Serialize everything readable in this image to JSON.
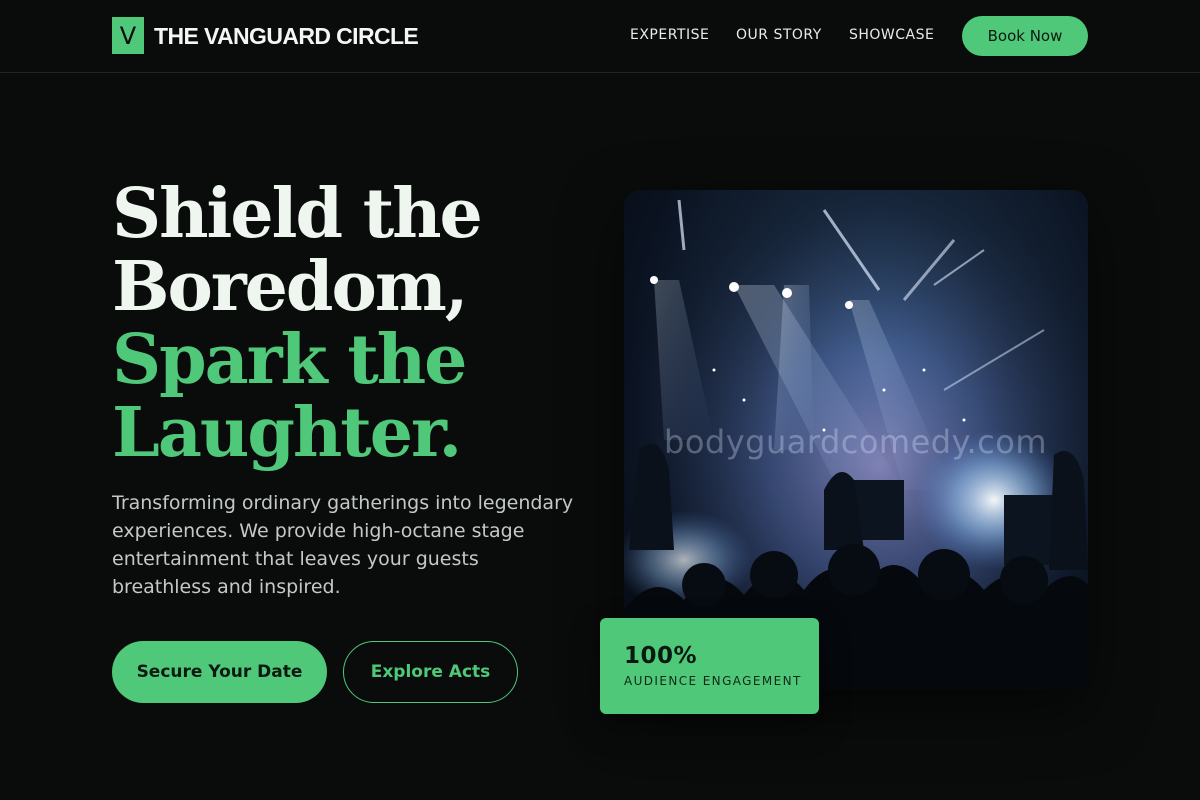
{
  "brand": {
    "mark": "V",
    "name": "THE VANGUARD CIRCLE"
  },
  "nav": {
    "links": [
      "EXPERTISE",
      "OUR STORY",
      "SHOWCASE"
    ],
    "cta": "Book Now"
  },
  "hero": {
    "title_lines": [
      "Shield the",
      "Boredom,",
      "Spark the",
      "Laughter."
    ],
    "description": "Transforming ordinary gatherings into legendary experiences. We provide high-octane stage entertainment that leaves your guests breathless and inspired.",
    "primary_cta": "Secure Your Date",
    "secondary_cta": "Explore Acts"
  },
  "image": {
    "watermark": "bodyguardcomedy.com"
  },
  "stat": {
    "value": "100%",
    "label": "AUDIENCE ENGAGEMENT"
  },
  "colors": {
    "background": "#0a0c0b",
    "accent": "#4fc879",
    "text": "#eef6ef",
    "muted": "#c3c9c5"
  }
}
